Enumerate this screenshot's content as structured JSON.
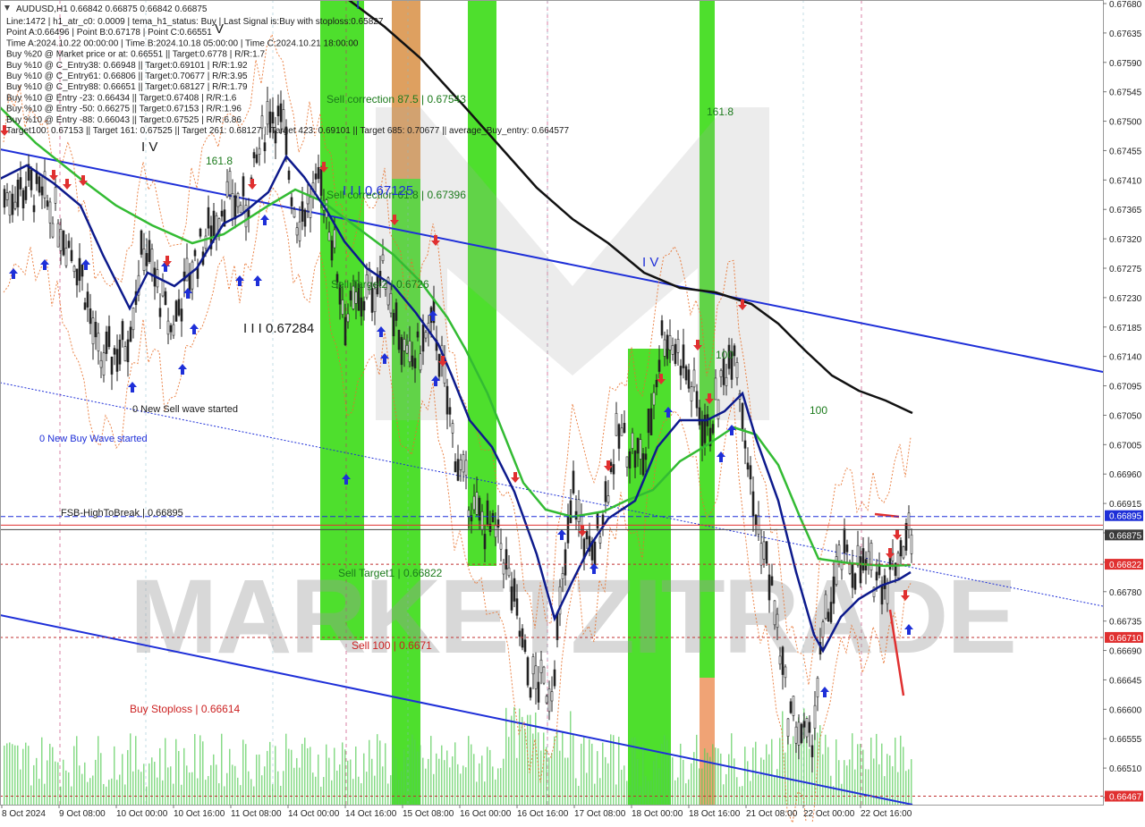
{
  "chart_data": {
    "type": "candlestick",
    "symbol_line": "AUDUSD,H1  0.66842 0.66875 0.66842 0.66875",
    "info_lines": [
      "Line:1472 | h1_atr_c0: 0.0009 | tema_h1_status: Buy | Last Signal is:Buy with stoploss:0.65827",
      "Point A:0.66496 | Point B:0.67178 | Point C:0.66551",
      "Time A:2024.10.22 00:00:00 | Time B:2024.10.18 05:00:00 | Time C:2024.10.21 18:00:00",
      "Buy %20 @ Market price or at: 0.66551 || Target:0.6778 | R/R:1.7",
      "Buy %10 @ C_Entry38: 0.66948 || Target:0.69101 | R/R:1.92",
      "Buy %10 @ C_Entry61: 0.66806 || Target:0.70677 | R/R:3.95",
      "Buy %10 @ C_Entry88: 0.66651 || Target:0.68127 | R/R:1.79",
      "Buy %10 @ Entry -23: 0.66434 || Target:0.67408 | R/R:1.6",
      "Buy %10 @ Entry -50: 0.66275 || Target:0.67153 | R/R:1.96",
      "Buy %10 @ Entry -88: 0.66043 || Target:0.67525 | R/R:6.86",
      "Target100: 0.67153 || Target 161: 0.67525 || Target 261: 0.68127 || Target 423: 0.69101 || Target 685: 0.70677 || average_Buy_entry: 0.664577"
    ],
    "y_ticks": [
      "0.67680",
      "0.67635",
      "0.67590",
      "0.67545",
      "0.67500",
      "0.67455",
      "0.67410",
      "0.67365",
      "0.67320",
      "0.67275",
      "0.67230",
      "0.67185",
      "0.67140",
      "0.67095",
      "0.67050",
      "0.67005",
      "0.66960",
      "0.66915",
      "0.66870",
      "0.66825",
      "0.66780",
      "0.66735",
      "0.66690",
      "0.66645",
      "0.66600",
      "0.66555",
      "0.66510",
      "0.66465"
    ],
    "x_ticks": [
      "8 Oct 2024",
      "9 Oct 08:00",
      "10 Oct 00:00",
      "10 Oct 16:00",
      "11 Oct 08:00",
      "14 Oct 00:00",
      "14 Oct 16:00",
      "15 Oct 08:00",
      "16 Oct 00:00",
      "16 Oct 16:00",
      "17 Oct 08:00",
      "18 Oct 00:00",
      "18 Oct 16:00",
      "21 Oct 08:00",
      "22 Oct 00:00",
      "22 Oct 16:00"
    ],
    "y_range": [
      0.6646,
      0.67685
    ],
    "price_badges": [
      {
        "value": "0.66895",
        "color": "#1e2fd8"
      },
      {
        "value": "0.66875",
        "color": "#3a3a3a"
      },
      {
        "value": "0.66822",
        "color": "#e03030"
      },
      {
        "value": "0.66710",
        "color": "#e03030"
      },
      {
        "value": "0.66467",
        "color": "#e03030"
      }
    ],
    "annotations": [
      {
        "text": "Sell correction 87.5 | 0.67543",
        "color": "#1b7a1b"
      },
      {
        "text": "Sell correction 61.8 | 0.67396",
        "color": "#1b7a1b"
      },
      {
        "text": "Sell Target2 | 0.6726",
        "color": "#1b7a1b"
      },
      {
        "text": "Sell Target1 | 0.66822",
        "color": "#1b7a1b"
      },
      {
        "text": "Sell 100 | 0.6671",
        "color": "#cc2222"
      },
      {
        "text": "Buy Stoploss | 0.66614",
        "color": "#cc2222"
      },
      {
        "text": "FSB-HighToBreak | 0.66895",
        "color": "#1a1a1a"
      },
      {
        "text": "0 New Buy Wave started",
        "color": "#1e2fd8"
      },
      {
        "text": "0 New Sell wave started",
        "color": "#1a1a1a"
      },
      {
        "text": "I I I 0.67125",
        "color": "#1e2fd8"
      },
      {
        "text": "I I I 0.67284",
        "color": "#1a1a1a"
      },
      {
        "text": "I V",
        "color": "#1e2fd8"
      },
      {
        "text": "I V",
        "color": "#1a1a1a"
      },
      {
        "text": "I",
        "color": "#1e2fd8"
      },
      {
        "text": "V",
        "color": "#1a1a1a"
      },
      {
        "text": "161.8",
        "color": "#1b7a1b"
      },
      {
        "text": "161.8",
        "color": "#1b7a1b"
      },
      {
        "text": "100",
        "color": "#1b7a1b"
      },
      {
        "text": "100",
        "color": "#1b7a1b"
      }
    ],
    "watermark": "MARKETZITRADE",
    "grid": false,
    "colors": {
      "up": "#2a2a2a",
      "ma_green": "#33bb33",
      "ma_navy": "#0d1a8c",
      "ma_black": "#111111",
      "channel": "#1e2fd8",
      "buy_arrow": "#1e2fd8",
      "sell_arrow": "#e03030",
      "envelope": "#e8702a"
    }
  }
}
